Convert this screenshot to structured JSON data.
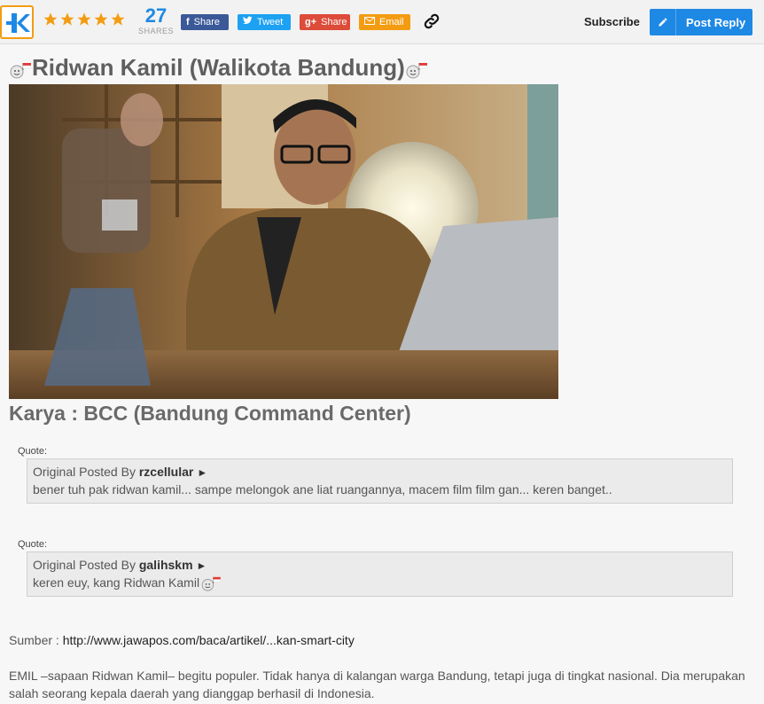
{
  "toolbar": {
    "shares_count": "27",
    "shares_label": "SHARES",
    "facebook_label": "Share",
    "twitter_label": "Tweet",
    "gplus_label": "Share",
    "email_label": "Email",
    "subscribe_label": "Subscribe",
    "post_reply_label": "Post Reply",
    "rating_stars": 5,
    "brand_color": "#1e88e5",
    "star_color": "#f39c12"
  },
  "post": {
    "title": "Ridwan Kamil (Walikota Bandung)",
    "subtitle": "Karya : BCC (Bandung Command Center)",
    "quotes": [
      {
        "label": "Quote:",
        "prefix": "Original Posted By ",
        "user": "rzcellular",
        "arrow": "►",
        "text": "bener tuh pak ridwan kamil... sampe melongok ane liat ruangannya, macem film film gan... keren banget.."
      },
      {
        "label": "Quote:",
        "prefix": "Original Posted By ",
        "user": "galihskm",
        "arrow": "►",
        "text": "keren euy, kang Ridwan Kamil"
      }
    ],
    "source_label": "Sumber : ",
    "source_link": "http://www.jawapos.com/baca/artikel/...kan-smart-city",
    "article_text": "EMIL –sapaan Ridwan Kamil– begitu populer. Tidak hanya di kalangan warga Bandung, tetapi juga di tingkat nasional. Dia merupakan salah seorang kepala daerah yang dianggap berhasil di Indonesia."
  }
}
